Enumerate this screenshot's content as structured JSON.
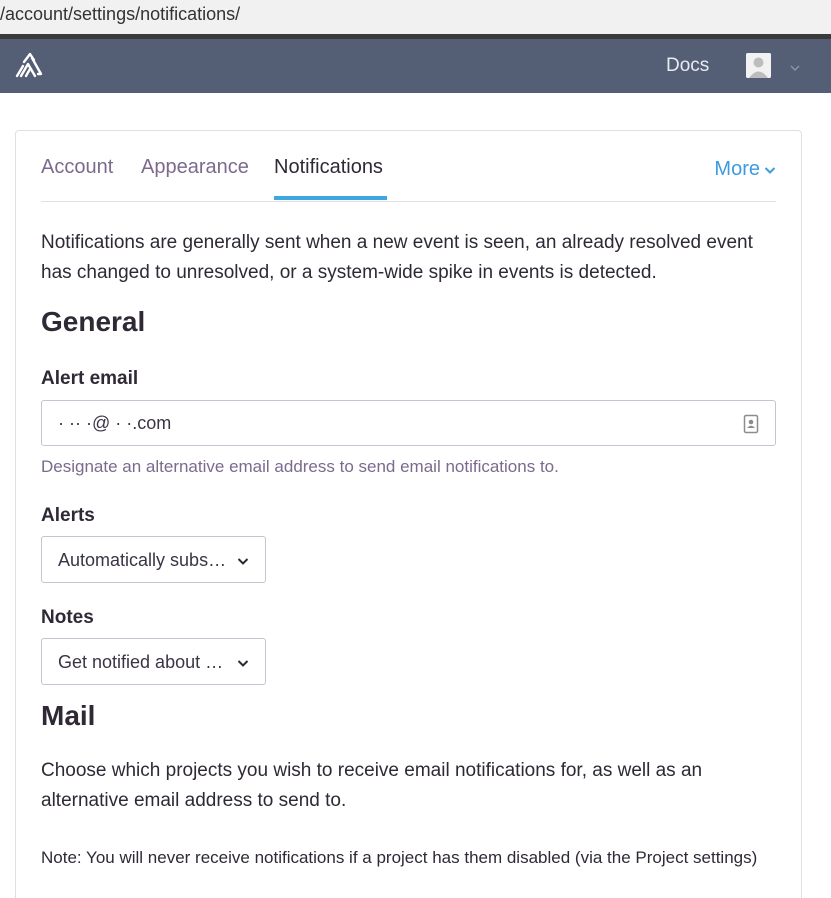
{
  "browser": {
    "url": "/account/settings/notifications/"
  },
  "topnav": {
    "docs_label": "Docs"
  },
  "tabs": [
    {
      "label": "Account"
    },
    {
      "label": "Appearance"
    },
    {
      "label": "Notifications",
      "active": true
    }
  ],
  "more_label": "More",
  "intro": "Notifications are generally sent when a new event is seen, an already resolved event has changed to unresolved, or a system-wide spike in events is detected.",
  "general": {
    "heading": "General",
    "alert_email": {
      "label": "Alert email",
      "value": "·  ··  ·@  ·  ·.com",
      "help": "Designate an alternative email address to send email notifications to."
    },
    "alerts": {
      "label": "Alerts",
      "selected": "Automatically subs…"
    },
    "notes": {
      "label": "Notes",
      "selected": "Get notified about …"
    }
  },
  "mail": {
    "heading": "Mail",
    "description": "Choose which projects you wish to receive email notifications for, as well as an alternative email address to send to.",
    "note": "Note: You will never receive notifications if a project has them disabled (via the Project settings)"
  },
  "colors": {
    "topnav_bg": "#545e75",
    "accent": "#3fa7e0",
    "link": "#3d9be0",
    "muted_text": "#7c6a8e"
  },
  "icons": [
    "sentry-logo-icon",
    "avatar-icon",
    "chevron-down-icon",
    "contact-card-icon"
  ]
}
